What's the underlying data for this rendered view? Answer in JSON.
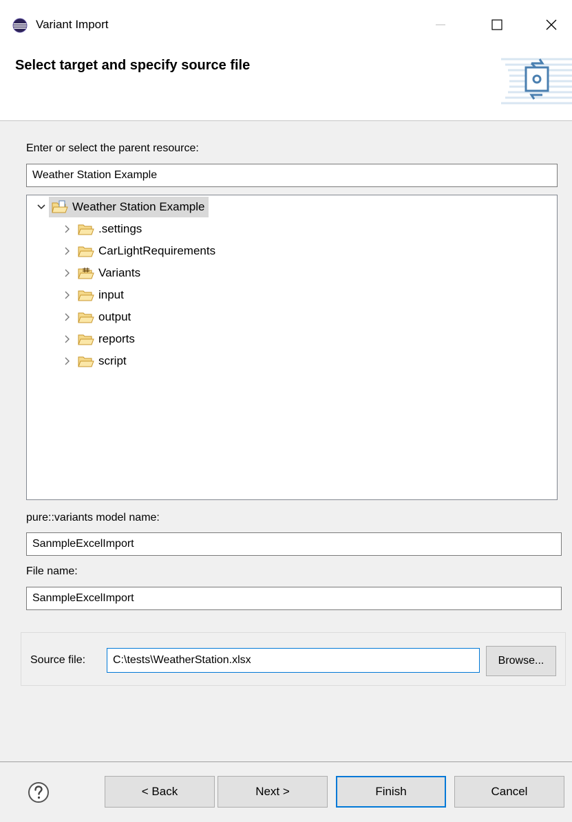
{
  "window": {
    "title": "Variant Import"
  },
  "header": {
    "title": "Select target and specify source file"
  },
  "parent_resource": {
    "label": "Enter or select the parent resource:",
    "value": "Weather Station Example"
  },
  "tree": {
    "root": {
      "label": "Weather Station Example",
      "expanded": true
    },
    "children": [
      {
        "label": ".settings",
        "icon": "folder-icon"
      },
      {
        "label": "CarLightRequirements",
        "icon": "folder-icon"
      },
      {
        "label": "Variants",
        "icon": "variants-folder-icon"
      },
      {
        "label": "input",
        "icon": "folder-icon"
      },
      {
        "label": "output",
        "icon": "folder-icon"
      },
      {
        "label": "reports",
        "icon": "folder-icon"
      },
      {
        "label": "script",
        "icon": "folder-icon"
      }
    ]
  },
  "model_name": {
    "label": "pure::variants model name:",
    "value": "SanmpleExcelImport"
  },
  "file_name": {
    "label": "File name:",
    "value": "SanmpleExcelImport"
  },
  "source_file": {
    "label": "Source file:",
    "value": "C:\\tests\\WeatherStation.xlsx",
    "browse_label": "Browse..."
  },
  "buttons": {
    "back": "< Back",
    "next": "Next >",
    "finish": "Finish",
    "cancel": "Cancel"
  },
  "colors": {
    "accent": "#0078d7",
    "tree_selection": "#d9d9d9",
    "folder": "#e8c56a"
  }
}
